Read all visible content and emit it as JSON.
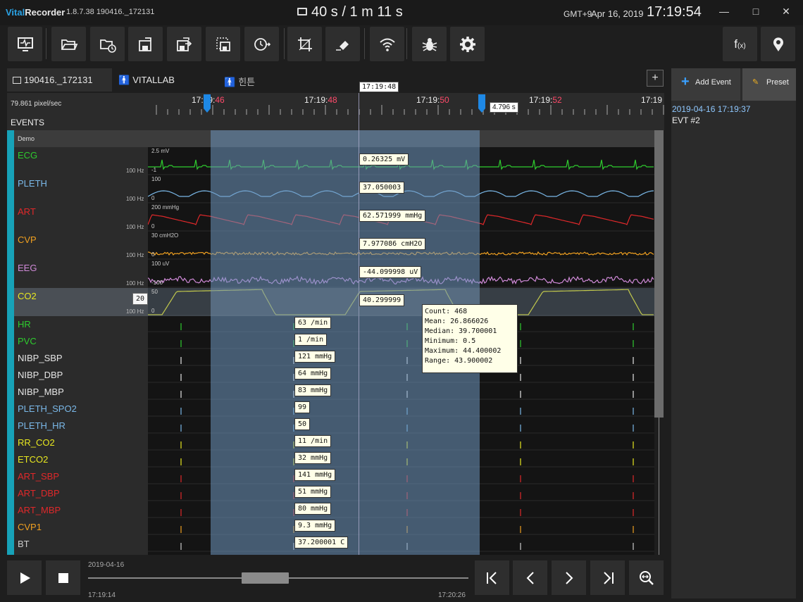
{
  "titlebar": {
    "app_name_vital": "Vital",
    "app_name_recorder": "Recorder",
    "version": "1.8.7.38 190416._172131",
    "duration": "40 s / 1 m 11 s",
    "timezone": "GMT+9",
    "date": "Apr 16, 2019",
    "clock": "17:19:54",
    "minimize": "—",
    "maximize": "□",
    "close": "✕"
  },
  "toolbar": {
    "buttons": [
      "monitor-icon",
      "folder-open-icon",
      "folder-clock-icon",
      "save-icon",
      "save-as-icon",
      "save-selection-icon",
      "timer-export-icon",
      "crop-icon",
      "eraser-icon",
      "wifi-icon",
      "bug-icon",
      "gear-icon"
    ],
    "fx_label": "f",
    "fx_sub": "(x)"
  },
  "tabs": {
    "file": "190416._172131",
    "vitallab": "VITALLAB",
    "hint": "힌튼",
    "add": "+"
  },
  "timeline": {
    "pixel_rate": "79.861 pixel/sec",
    "ticks": [
      {
        "base": "17:19:",
        "sec": "46"
      },
      {
        "base": "17:19:",
        "sec": "48"
      },
      {
        "base": "17:19:",
        "sec": "50"
      },
      {
        "base": "17:19:",
        "sec": "52"
      },
      {
        "base": "17:19",
        "sec": ""
      }
    ],
    "cursor_time": "17:19:48",
    "selection_width": "4.796 s"
  },
  "events": {
    "header": "EVENTS",
    "demo": "Demo"
  },
  "waves": [
    {
      "name": "ECG",
      "color": "#2ecc2e",
      "hz": "100 Hz",
      "top": "2.5 mV",
      "bottom": "-1",
      "value": "0.26325 mV"
    },
    {
      "name": "PLETH",
      "color": "#7ab8e8",
      "hz": "100 Hz",
      "top": "100",
      "bottom": "0",
      "value": "37.050003"
    },
    {
      "name": "ART",
      "color": "#e0282a",
      "hz": "100 Hz",
      "top": "200 mmHg",
      "bottom": "0",
      "value": "62.571999 mmHg"
    },
    {
      "name": "CVP",
      "color": "#f0a020",
      "hz": "100 Hz",
      "top": "30 cmH2O",
      "bottom": "0",
      "value": "7.977086 cmH2O"
    },
    {
      "name": "EEG",
      "color": "#d08ad8",
      "hz": "100 Hz",
      "top": "100 uV",
      "bottom": "-100",
      "value": "-44.099998 uV"
    },
    {
      "name": "CO2",
      "color": "#e8e820",
      "hz": "100 Hz",
      "top": "50",
      "bottom": "0",
      "value": "40.299999",
      "setting": "20"
    }
  ],
  "numerics": [
    {
      "name": "HR",
      "color": "#2ecc2e",
      "value": "63 /min"
    },
    {
      "name": "PVC",
      "color": "#2ecc2e",
      "value": "1 /min"
    },
    {
      "name": "NIBP_SBP",
      "color": "#e6e6e6",
      "value": "121 mmHg"
    },
    {
      "name": "NIBP_DBP",
      "color": "#e6e6e6",
      "value": "64 mmHg"
    },
    {
      "name": "NIBP_MBP",
      "color": "#e6e6e6",
      "value": "83 mmHg"
    },
    {
      "name": "PLETH_SPO2",
      "color": "#7ab8e8",
      "value": "99"
    },
    {
      "name": "PLETH_HR",
      "color": "#7ab8e8",
      "value": "50"
    },
    {
      "name": "RR_CO2",
      "color": "#e8e820",
      "value": "11 /min"
    },
    {
      "name": "ETCO2",
      "color": "#e8e820",
      "value": "32 mmHg"
    },
    {
      "name": "ART_SBP",
      "color": "#e0282a",
      "value": "141 mmHg"
    },
    {
      "name": "ART_DBP",
      "color": "#e0282a",
      "value": "51 mmHg"
    },
    {
      "name": "ART_MBP",
      "color": "#e0282a",
      "value": "80 mmHg"
    },
    {
      "name": "CVP1",
      "color": "#f0a020",
      "value": "9.3 mmHg"
    },
    {
      "name": "BT",
      "color": "#cccccc",
      "value": "37.200001 C"
    }
  ],
  "stats": [
    "Count: 468",
    "Mean: 26.866026",
    "Median: 39.700001",
    "Minimum: 0.5",
    "Maximum: 44.400002",
    "Range: 43.900002"
  ],
  "right_panel": {
    "add_event": "Add Event",
    "preset": "Preset",
    "event_time": "2019-04-16 17:19:37",
    "event_name": "EVT #2"
  },
  "playback": {
    "date": "2019-04-16",
    "start": "17:19:14",
    "end": "17:20:26",
    "position": 0.46
  }
}
